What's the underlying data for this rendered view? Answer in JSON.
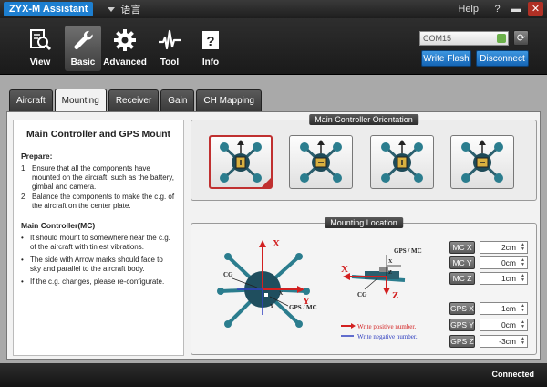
{
  "titlebar": {
    "app_title": "ZYX-M Assistant",
    "language": "语言",
    "help": "Help",
    "question": "?",
    "minimize": "▬",
    "close": "✕"
  },
  "toolbar": {
    "items": [
      {
        "label": "View",
        "icon": "magnifier-document-icon"
      },
      {
        "label": "Basic",
        "icon": "wrench-icon"
      },
      {
        "label": "Advanced",
        "icon": "gear-icon"
      },
      {
        "label": "Tool",
        "icon": "waveform-icon"
      },
      {
        "label": "Info",
        "icon": "info-document-icon"
      }
    ],
    "active": "Basic",
    "com_port": "COM15",
    "refresh": "⟳",
    "write_flash": "Write Flash",
    "disconnect": "Disconnect"
  },
  "tabs": [
    "Aircraft",
    "Mounting",
    "Receiver",
    "Gain",
    "CH Mapping"
  ],
  "active_tab": "Mounting",
  "instructions": {
    "title": "Main Controller and GPS Mount",
    "prepare_heading": "Prepare:",
    "prepare_items": [
      {
        "num": "1.",
        "text": "Ensure that all the components have mounted on the aircraft, such as the battery, gimbal and camera."
      },
      {
        "num": "2.",
        "text": "Balance the components to make the c.g. of the aircraft on the center plate."
      }
    ],
    "mc_heading": "Main Controller(MC)",
    "mc_items": [
      {
        "num": "•",
        "text": "It should mount to somewhere near the c.g. of the aircraft with tiniest vibrations."
      },
      {
        "num": "•",
        "text": "The side with Arrow marks should face to sky and parallel to the aircraft body."
      },
      {
        "num": "•",
        "text": "If the c.g. changes, please re-configurate."
      }
    ]
  },
  "orientation": {
    "title": "Main Controller Orientation",
    "selected_index": 0,
    "options": 4
  },
  "mounting": {
    "title": "Mounting Location",
    "diagram_labels": {
      "x": "X",
      "y": "Y",
      "z": "Z",
      "cg": "CG",
      "gps_mc": "GPS / MC",
      "write_positive": "Write positive number.",
      "write_negative": "Write negative number."
    },
    "params": [
      {
        "label": "MC X",
        "value": "2cm"
      },
      {
        "label": "MC Y",
        "value": "0cm"
      },
      {
        "label": "MC Z",
        "value": "1cm"
      },
      {
        "label": "GPS X",
        "value": "1cm"
      },
      {
        "label": "GPS Y",
        "value": "0cm"
      },
      {
        "label": "GPS Z",
        "value": "-3cm"
      }
    ]
  },
  "status": "Connected",
  "colors": {
    "accent_blue": "#1d7fd0",
    "positive_red": "#d22020",
    "negative_blue": "#3040c0",
    "selection_red": "#c03030",
    "aircraft_teal": "#2b7d8e"
  }
}
